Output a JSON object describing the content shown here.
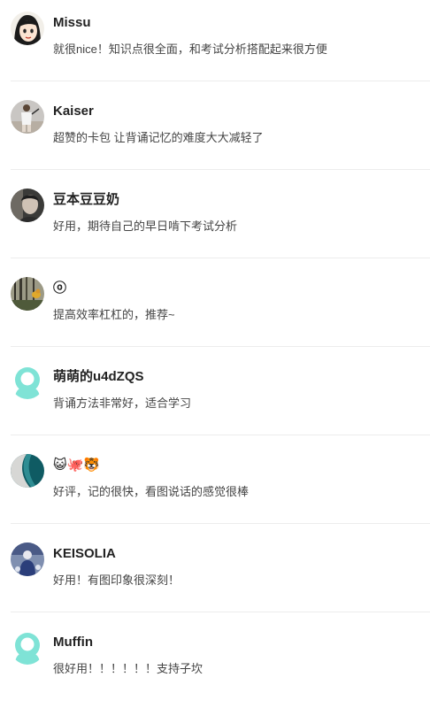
{
  "reviews": [
    {
      "avatar": "anime-girl-avatar",
      "username": "Missu",
      "comment": "就很nice！知识点很全面，和考试分析搭配起来很方便"
    },
    {
      "avatar": "tennis-player-avatar",
      "username": "Kaiser",
      "comment": "超赞的卡包 让背诵记忆的难度大大减轻了"
    },
    {
      "avatar": "portrait-avatar",
      "username": "豆本豆豆奶",
      "comment": "好用，期待自己的早日啃下考试分析"
    },
    {
      "avatar": "forest-bird-avatar",
      "username": "ⓞ",
      "comment": "提高效率杠杠的，推荐~"
    },
    {
      "avatar": "default-user-avatar",
      "username": "萌萌的u4dZQS",
      "comment": "背诵方法非常好，适合学习"
    },
    {
      "avatar": "ocean-wave-avatar",
      "username": "😺🐙🐯",
      "comment": "好评，记的很快，看图说话的感觉很棒"
    },
    {
      "avatar": "blue-figure-avatar",
      "username": "KEISOLIA",
      "comment": "好用！有图印象很深刻！"
    },
    {
      "avatar": "default-user-avatar",
      "username": "Muffin",
      "comment": "很好用！！！！！！支持子坎"
    }
  ],
  "colors": {
    "default_avatar": "#7fe3d6",
    "divider": "#ececec",
    "username": "#222222",
    "comment": "#444444"
  }
}
